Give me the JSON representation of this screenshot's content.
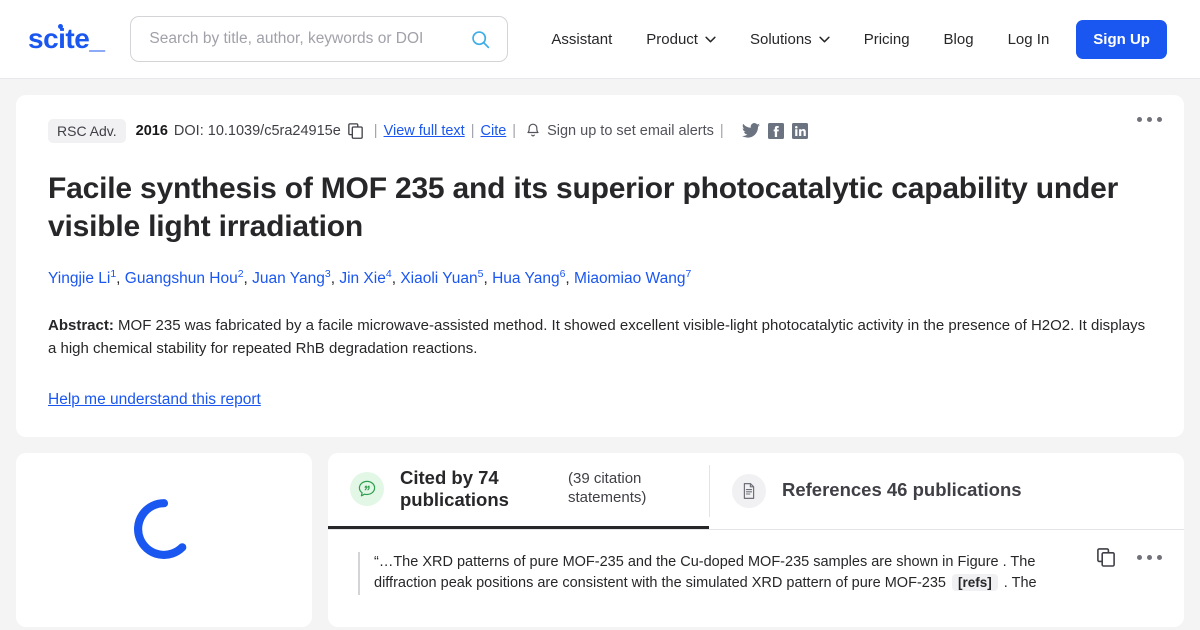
{
  "brand": {
    "name": "scite_",
    "accent": "#1a56f0",
    "search_accent": "#3eaee8"
  },
  "header": {
    "search": {
      "placeholder": "Search by title, author, keywords or DOI",
      "value": "",
      "icon": "search-icon"
    },
    "nav": [
      {
        "label": "Assistant",
        "caret": false
      },
      {
        "label": "Product",
        "caret": true
      },
      {
        "label": "Solutions",
        "caret": true
      },
      {
        "label": "Pricing",
        "caret": false
      },
      {
        "label": "Blog",
        "caret": false
      }
    ],
    "login_label": "Log In",
    "signup_label": "Sign Up"
  },
  "paper": {
    "journal": "RSC Adv.",
    "year": "2016",
    "doi_label": "DOI: 10.1039/c5ra24915e",
    "copy_icon": "copy-icon",
    "view_full_text": "View full text",
    "cite": "Cite",
    "alerts_text": "Sign up to set email alerts",
    "bell_icon": "bell-icon",
    "separator": "|",
    "social": [
      {
        "name": "twitter-icon"
      },
      {
        "name": "facebook-icon"
      },
      {
        "name": "linkedin-icon"
      }
    ],
    "more_icon": "kebab-menu-icon",
    "title": "Facile synthesis of MOF 235 and its superior photocatalytic capability under visible light irradiation",
    "authors": [
      {
        "name": "Yingjie Li",
        "sup": "1"
      },
      {
        "name": "Guangshun Hou",
        "sup": "2"
      },
      {
        "name": "Juan Yang",
        "sup": "3"
      },
      {
        "name": "Jin Xie",
        "sup": "4"
      },
      {
        "name": "Xiaoli Yuan",
        "sup": "5"
      },
      {
        "name": "Hua Yang",
        "sup": "6"
      },
      {
        "name": "Miaomiao Wang",
        "sup": "7"
      }
    ],
    "abstract_label": "Abstract:",
    "abstract_text": " MOF 235 was fabricated by a facile microwave-assisted method. It showed excellent visible-light photocatalytic activity in the presence of H2O2. It displays a high chemical stability for repeated RhB degradation reactions.",
    "help_link": "Help me understand this report"
  },
  "left_panel": {
    "state": "loading",
    "spinner_color": "#1a56f0"
  },
  "tabs": [
    {
      "id": "cited-by",
      "icon": "quote-bubble-icon",
      "label": "Cited by 74 publications",
      "sub": "(39 citation statements)",
      "active": true
    },
    {
      "id": "references",
      "icon": "document-icon",
      "label": "References 46 publications",
      "sub": "",
      "active": false
    }
  ],
  "statement": {
    "part1": "“…The XRD patterns of pure MOF-235 and the Cu-doped MOF-235 samples are shown in Figure . The diffraction peak positions are consistent with the simulated XRD pattern of pure MOF-235 ",
    "refs_chip": "[refs]",
    "part2": " . The",
    "copy_icon": "copy-icon",
    "more_icon": "kebab-menu-icon"
  }
}
